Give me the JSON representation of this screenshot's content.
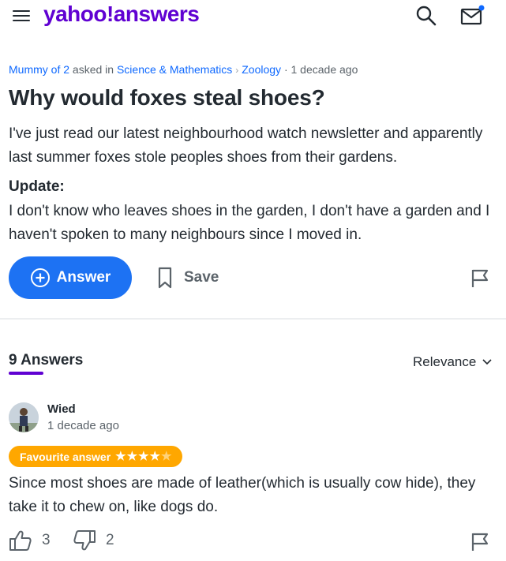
{
  "header": {
    "logo_yahoo": "yahoo!",
    "logo_answers": "answers",
    "icons": [
      "menu-icon",
      "search-icon",
      "mail-icon"
    ]
  },
  "question": {
    "author": "Mummy of 2",
    "asked_in": "asked in",
    "category": "Science & Mathematics",
    "subcategory": "Zoology",
    "time": "· 1 decade ago",
    "title": "Why would foxes steal shoes?",
    "body": "I've just read our latest neighbourhood watch newsletter and apparently last summer foxes stole peoples shoes from their gardens.",
    "update_label": "Update:",
    "update_body": "I don't know who leaves shoes in the garden, I don't have a garden and I haven't spoken to many neighbours since I moved in."
  },
  "actions": {
    "answer_label": "Answer",
    "save_label": "Save"
  },
  "answers_section": {
    "count_label": "9 Answers",
    "sort_label": "Relevance"
  },
  "answers": [
    {
      "author": "Wied",
      "time": "1 decade ago",
      "badge": "Favourite answer",
      "rating": 4,
      "rating_max": 5,
      "body": "Since most shoes are made of leather(which is usually cow hide), they take it to chew on, like dogs do.",
      "upvotes": "3",
      "downvotes": "2"
    }
  ],
  "colors": {
    "brand_purple": "#6001d2",
    "link_blue": "#0f69ff",
    "button_blue": "#1d72f3",
    "badge_orange": "#ffa700"
  }
}
